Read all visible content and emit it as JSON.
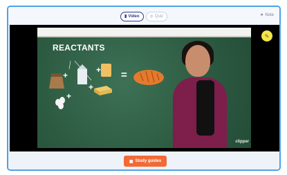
{
  "topbar": {
    "tabs": [
      {
        "label": "Video",
        "icon": "video-icon",
        "active": true
      },
      {
        "label": "Quiz",
        "icon": "quiz-icon",
        "active": false
      }
    ],
    "notes_label": "Note",
    "notes_icon": "star-icon"
  },
  "video": {
    "slide_title": "REACTANTS",
    "items": [
      "flour-bag-icon",
      "milk-carton-icon",
      "yeast-icon",
      "butter-icon",
      "egg-icon"
    ],
    "result_icon": "bread-icon",
    "logo_text": "clipper",
    "accent_color": "#f2e44b"
  },
  "footer": {
    "study_button_label": "Study guides",
    "study_button_color": "#f26a36"
  }
}
